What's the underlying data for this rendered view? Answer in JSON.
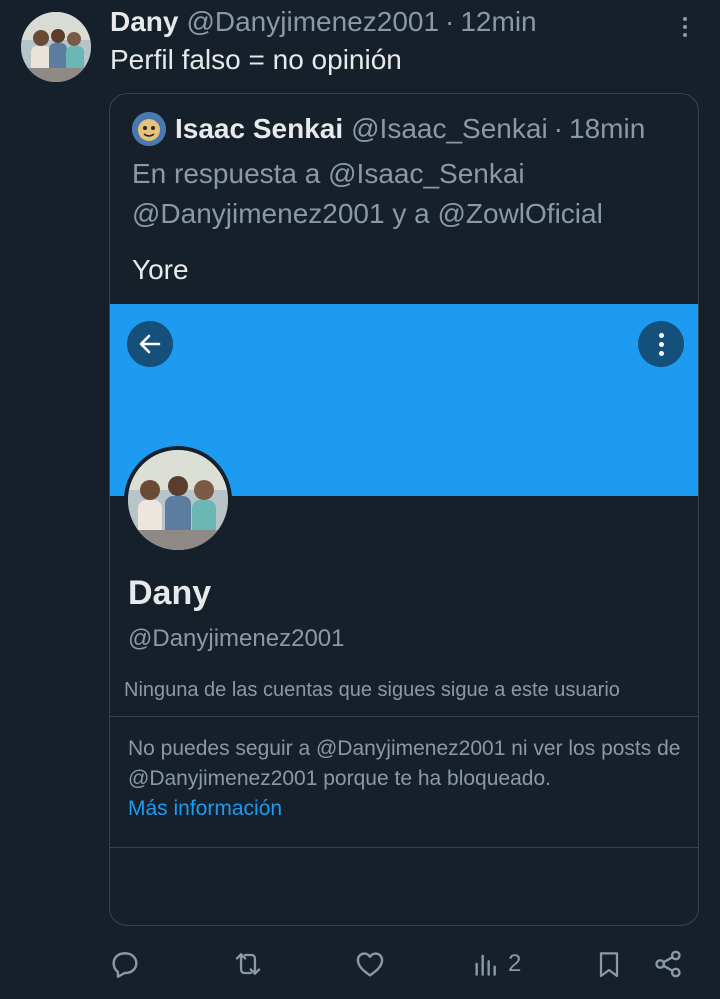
{
  "tweet": {
    "author_name": "Dany",
    "author_handle": "@Danyjimenez2001",
    "separator": "·",
    "time": "12min",
    "text": "Perfil falso = no opinión"
  },
  "quote": {
    "author_name": "Isaac Senkai",
    "author_handle": "@Isaac_Senkai",
    "separator": "·",
    "time": "18min",
    "reply_prefix": "En respuesta a @Isaac_Senkai",
    "reply_mentions": "@Danyjimenez2001 y a @ZowlOficial",
    "text": "Yore",
    "screenshot": {
      "profile_name": "Dany",
      "profile_handle": "@Danyjimenez2001",
      "follow_note": "Ninguna de las cuentas que sigues sigue a este usuario",
      "blocked_text": "No puedes seguir a @Danyjimenez2001 ni ver los posts de @Danyjimenez2001 porque te ha bloqueado.",
      "more_info_link": "Más información",
      "banner_color": "#1d9bf0"
    }
  },
  "actions": {
    "reply_icon": "reply-icon",
    "retweet_icon": "retweet-icon",
    "like_icon": "heart-icon",
    "views_icon": "views-icon",
    "views_count": "2",
    "bookmark_icon": "bookmark-icon",
    "share_icon": "share-icon"
  },
  "colors": {
    "background": "#15202b",
    "accent": "#1d9bf0",
    "muted_text": "#8b98a5"
  }
}
